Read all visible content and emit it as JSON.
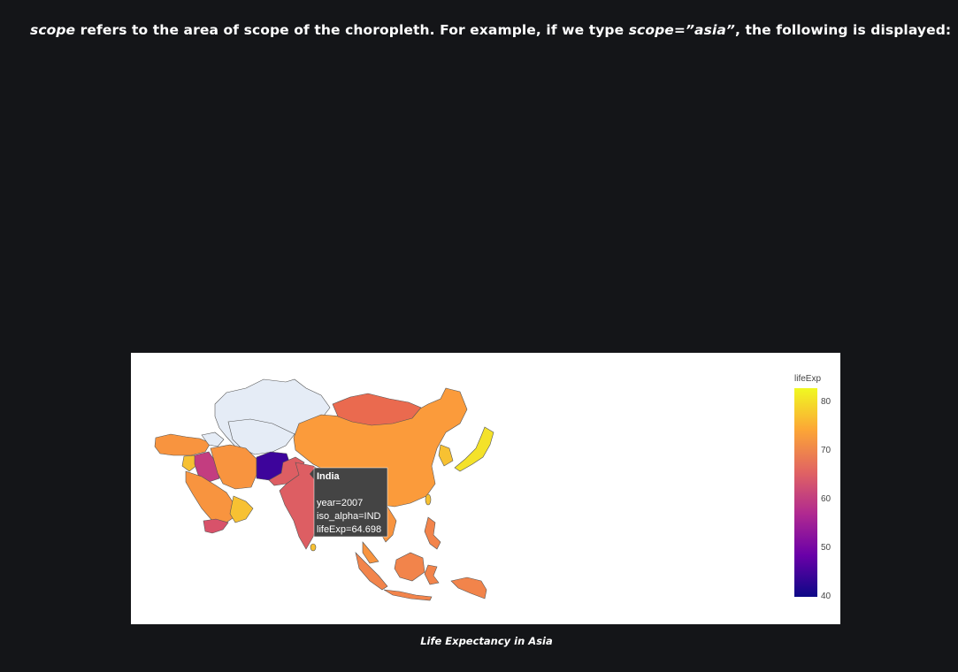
{
  "article": {
    "para_scope": "scope",
    "para_text1": " refers to the area of scope of the choropleth. For example, if we type ",
    "para_code": "scope=”asia”",
    "para_text2": ", the following is displayed:"
  },
  "figure": {
    "caption": "Life Expectancy in Asia",
    "colorbar": {
      "title": "lifeExp",
      "ticks": [
        "80",
        "70",
        "60",
        "50",
        "40"
      ],
      "colors": [
        "#0d0887",
        "#6a00a8",
        "#b12a90",
        "#e16462",
        "#fca636",
        "#f0f921"
      ]
    },
    "tooltip": {
      "name": "India",
      "line1": "year=2007",
      "line2": "iso_alpha=IND",
      "line3": "lifeExp=64.698"
    },
    "map_colors": {
      "no_data": "#e5ecf6",
      "china": "#fb9b3b",
      "mongolia": "#ea6a4f",
      "india": "#dd5e63",
      "afghanistan": "#3d049b",
      "iraq": "#c33d80",
      "japan": "#f4e22a",
      "yemen": "#d8526a",
      "high": "#f7c132",
      "mid": "#f8943f",
      "indonesia": "#f2844b"
    }
  }
}
